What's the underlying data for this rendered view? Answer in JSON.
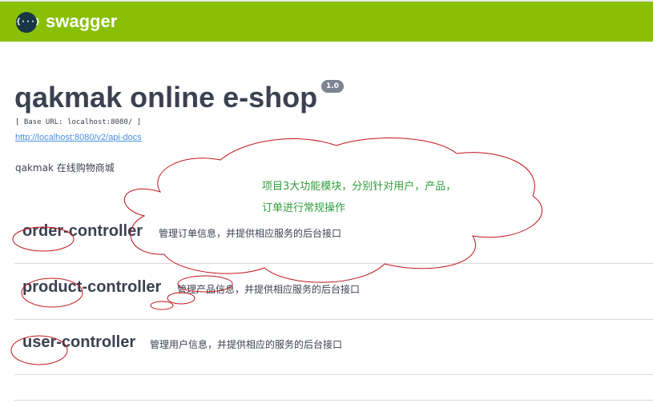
{
  "header": {
    "logo_glyph": "{···}",
    "brand": "swagger",
    "bar_color": "#89bf04"
  },
  "info": {
    "title": "qakmak online e-shop",
    "version": "1.0",
    "base_url": "[ Base URL: localhost:8080/ ]",
    "docs_link": "http://localhost:8080/v2/api-docs",
    "description": "qakmak 在线购物商城"
  },
  "controllers": [
    {
      "name": "order-controller",
      "description": "管理订单信息，并提供相应服务的后台接口"
    },
    {
      "name": "product-controller",
      "description": "管理产品信息，并提供相应服务的后台接口"
    },
    {
      "name": "user-controller",
      "description": "管理用户信息，并提供相应的服务的后台接口"
    }
  ],
  "annotation": {
    "line1": "项目3大功能模块，分别针对用户，产品，",
    "line2": "订单进行常规操作",
    "ink_color": "#c0141c",
    "text_color": "#2e9e3a"
  }
}
